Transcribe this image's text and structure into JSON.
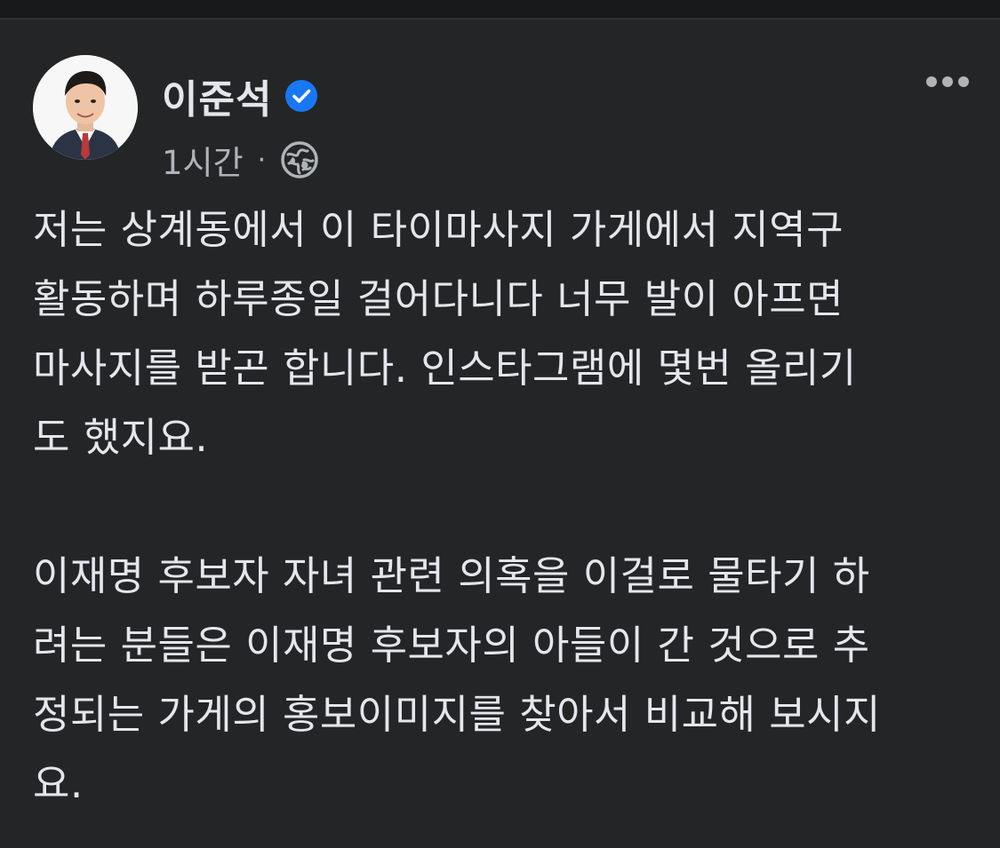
{
  "post": {
    "author": {
      "name": "이준석",
      "verified": true,
      "avatar_icon": "profile-photo"
    },
    "meta": {
      "time": "1시간",
      "separator": "·",
      "audience_icon": "globe-icon"
    },
    "more_icon": "more-horizontal-icon",
    "body": {
      "paragraph1": [
        "저는 상계동에서 이 타이마사지 가게에서 지역구",
        "활동하며 하루종일 걸어다니다 너무 발이 아프면",
        "마사지를 받곤 합니다. 인스타그램에 몇번 올리기",
        "도 했지요."
      ],
      "paragraph2": [
        "이재명 후보자 자녀 관련 의혹을 이걸로 물타기 하",
        "려는 분들은 이재명 후보자의 아들이 간 것으로 추",
        "정되는 가게의 홍보이미지를 찾아서 비교해 보시지",
        "요."
      ]
    }
  },
  "colors": {
    "background": "#242527",
    "text_primary": "#e4e6eb",
    "text_secondary": "#b0b3b8",
    "verified_badge": "#1877f2"
  }
}
